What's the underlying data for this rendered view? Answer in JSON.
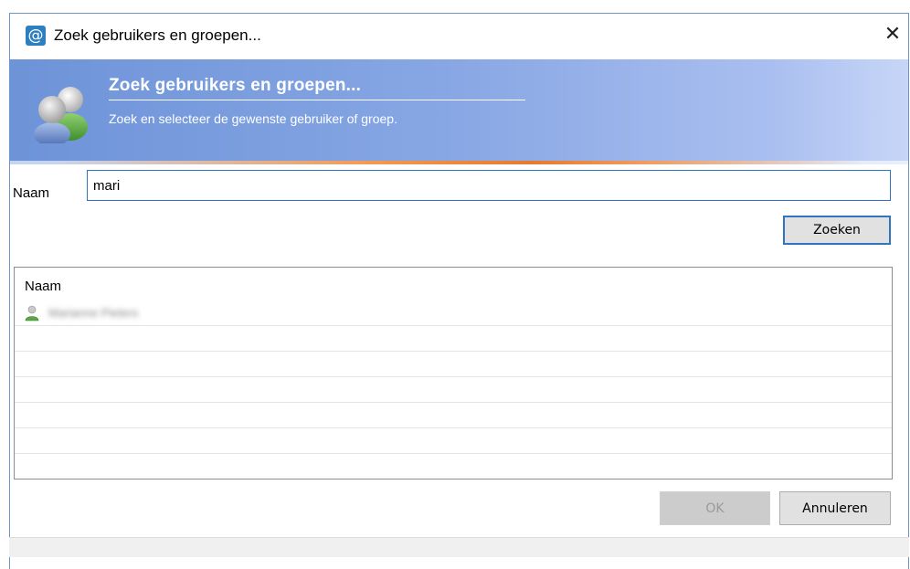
{
  "window": {
    "title": "Zoek gebruikers en groepen...",
    "app_icon": "at-sign-icon",
    "close_glyph": "✕"
  },
  "banner": {
    "title": "Zoek gebruikers en groepen...",
    "subtitle": "Zoek en selecteer de gewenste gebruiker of groep.",
    "icon": "users-icon"
  },
  "search": {
    "label": "Naam",
    "value": "mari",
    "button_label": "Zoeken"
  },
  "results": {
    "column_header": "Naam",
    "rows": [
      {
        "name": "Marianne Pieters",
        "icon": "user-icon"
      }
    ]
  },
  "buttons": {
    "ok_label": "OK",
    "cancel_label": "Annuleren"
  },
  "colors": {
    "accent": "#2e74c0",
    "banner_blue": "#6d93d8",
    "banner_orange": "#e87a2e"
  }
}
